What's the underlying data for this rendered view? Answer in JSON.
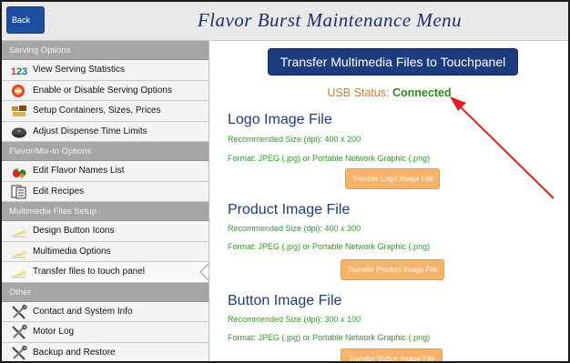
{
  "header": {
    "back_label": "Back",
    "title": "Flavor Burst Maintenance Menu"
  },
  "sidebar": {
    "sections": [
      {
        "label": "Serving Options",
        "items": [
          {
            "label": "View Serving Statistics",
            "icon": "numbers-123-icon"
          },
          {
            "label": "Enable or Disable Serving Options",
            "icon": "no-entry-icon"
          },
          {
            "label": "Setup Containers, Sizes, Prices",
            "icon": "containers-icon"
          },
          {
            "label": "Adjust Dispense Time Limits",
            "icon": "timer-disc-icon"
          }
        ]
      },
      {
        "label": "Flavor/Mix-In Options",
        "items": [
          {
            "label": "Edit Flavor Names List",
            "icon": "fruit-icon"
          },
          {
            "label": "Edit Recipes",
            "icon": "recipe-document-icon"
          }
        ]
      },
      {
        "label": "Multimedia Files Setup",
        "items": [
          {
            "label": "Design Button Icons",
            "icon": "cone-icon"
          },
          {
            "label": "Multimedia Options",
            "icon": "cone-icon"
          },
          {
            "label": "Transfer files to touch panel",
            "icon": "cone-icon",
            "active": true
          }
        ]
      },
      {
        "label": "Other",
        "items": [
          {
            "label": "Contact and System Info",
            "icon": "tools-icon"
          },
          {
            "label": "Motor Log",
            "icon": "tools-icon"
          },
          {
            "label": "Backup and Restore",
            "icon": "tools-icon"
          }
        ]
      }
    ]
  },
  "main": {
    "transfer_button": "Transfer Multimedia Files to Touchpanel",
    "usb_label": "USB Status:",
    "usb_value": "Connected",
    "blocks": [
      {
        "title": "Logo Image File",
        "size": "Recommended Size (dpi): 400 x 200",
        "format": "Format: JPEG (.jpg) or Portable Network Graphic (.png)",
        "button": "Transfer Logo Image File"
      },
      {
        "title": "Product Image File",
        "size": "Recommended Size (dpi): 400 x 300",
        "format": "Format: JPEG (.jpg) or Portable Network Graphic (.png)",
        "button": "Transfer Product Image File"
      },
      {
        "title": "Button Image File",
        "size": "Recommended Size (dpi): 300 x 100",
        "format": "Format: JPEG (.jpg) or Portable Network Graphic (.png)",
        "button": "Transfer Button Image File"
      }
    ]
  },
  "colors": {
    "header_title": "#1d2f6e",
    "back_button": "#1f4fa0",
    "transfer_button": "#1d3b7f",
    "section_header": "#a6a6a6",
    "usb_label": "#d47b2c",
    "usb_connected": "#2d8a22",
    "info_text": "#2f9a2a",
    "orange_button": "#f6b46a",
    "annotation_arrow": "#e02020"
  }
}
